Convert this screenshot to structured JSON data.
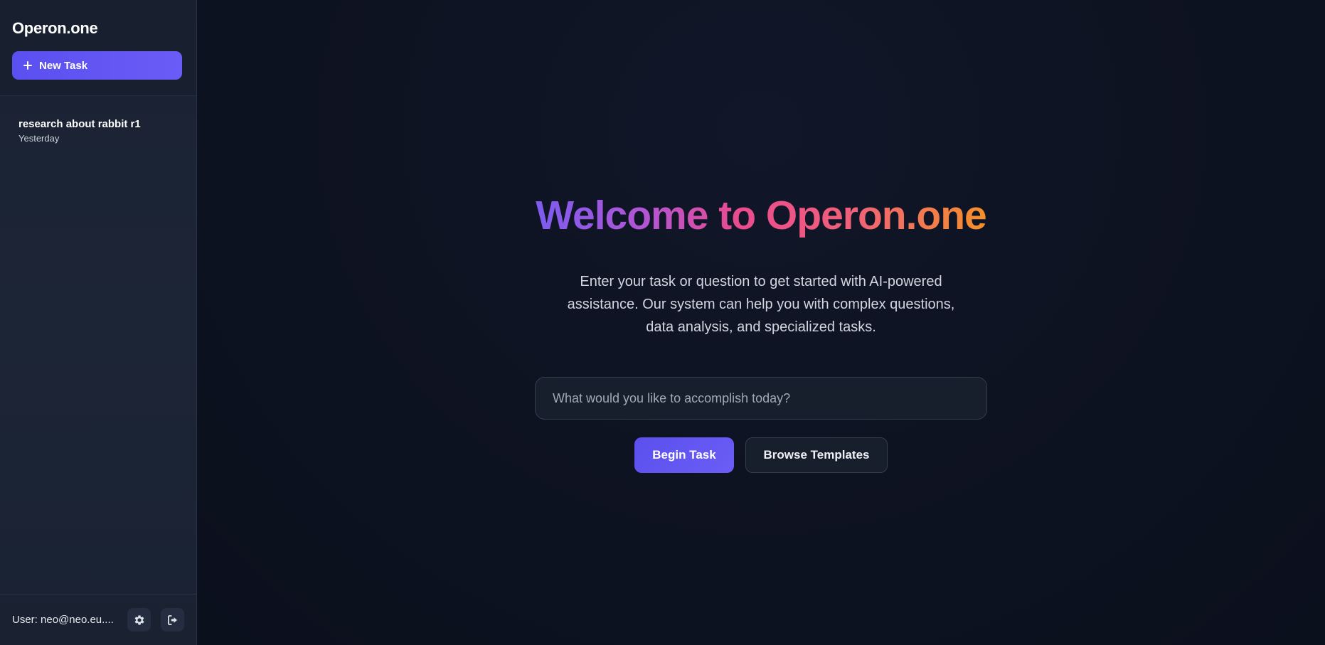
{
  "sidebar": {
    "brand": "Operon.one",
    "new_task_label": "New Task",
    "history": [
      {
        "title": "research about rabbit r1",
        "date": "Yesterday"
      }
    ],
    "user_label": "User: neo@neo.eu....",
    "settings_icon": "gear-icon",
    "logout_icon": "sign-out-icon"
  },
  "main": {
    "title": "Welcome to Operon.one",
    "description": "Enter your task or question to get started with AI-powered assistance. Our system can help you with complex questions, data analysis, and specialized tasks.",
    "input_placeholder": "What would you like to accomplish today?",
    "input_value": "",
    "begin_label": "Begin Task",
    "browse_label": "Browse Templates"
  },
  "colors": {
    "accent": "#5b50ee",
    "gradient_start": "#7b5cf0",
    "gradient_mid": "#ea4b8e",
    "gradient_end": "#f4902a",
    "background": "#0d1221",
    "sidebar_bg": "#1c2536"
  }
}
